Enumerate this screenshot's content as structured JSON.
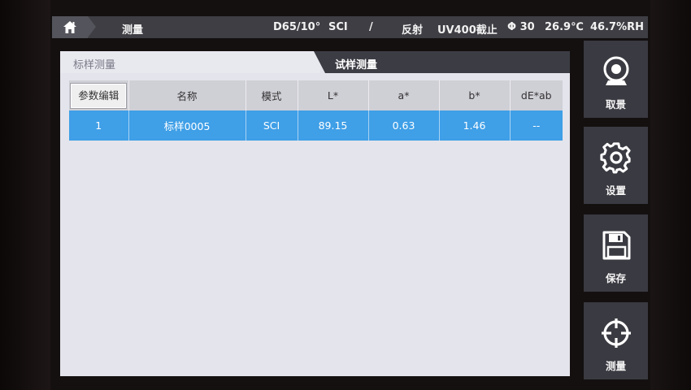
{
  "status_bar": {
    "title": "测量",
    "illuminant": "D65/10°",
    "mode": "SCI",
    "separator": "/",
    "measure_type": "反射",
    "uv": "UV400截止",
    "aperture": "Φ 30",
    "temperature": "26.9℃",
    "humidity": "46.7%RH"
  },
  "tabs": {
    "standard": "标样测量",
    "sample": "试样测量"
  },
  "table": {
    "param_edit_button": "参数编辑",
    "columns": [
      "名称",
      "模式",
      "L*",
      "a*",
      "b*",
      "dE*ab"
    ],
    "rows": [
      {
        "index": "1",
        "name": "标样0005",
        "mode": "SCI",
        "L": "89.15",
        "a": "0.63",
        "b": "1.46",
        "dE": "--"
      }
    ]
  },
  "side_buttons": {
    "capture": "取景",
    "settings": "设置",
    "save": "保存",
    "measure": "测量"
  },
  "icons": {
    "home": "home-icon",
    "capture": "camera-icon",
    "settings": "gear-icon",
    "save": "floppy-disk-icon",
    "measure": "crosshair-icon"
  },
  "colors": {
    "selected_row": "#3f9fe7",
    "status_bar": "#3e3e44",
    "side_button": "#3a3a42",
    "panel": "#e4e4ec"
  }
}
